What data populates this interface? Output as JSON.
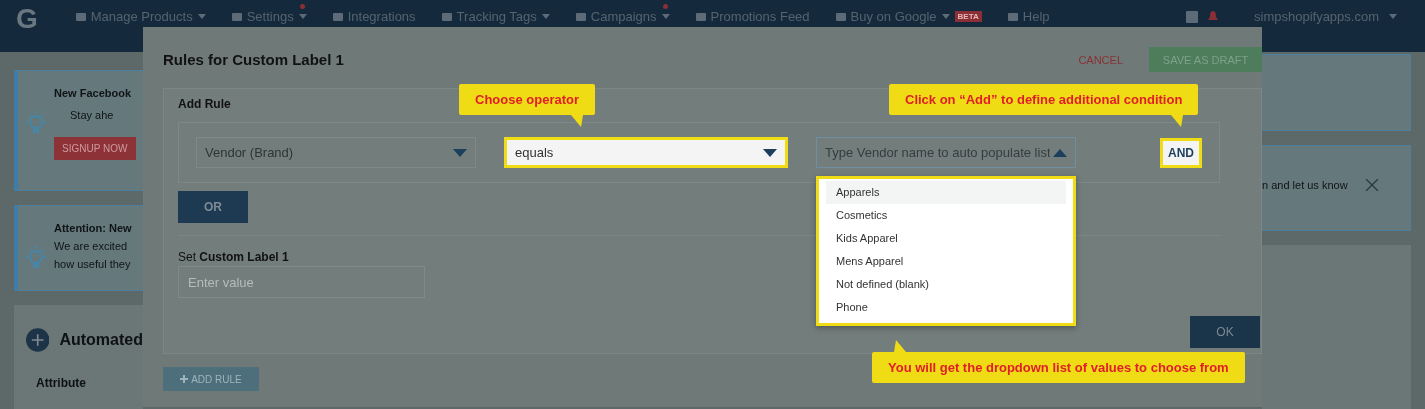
{
  "nav": {
    "logo": "G",
    "items": [
      {
        "label": "Manage Products",
        "caret": true,
        "alert": false
      },
      {
        "label": "Settings",
        "caret": true,
        "alert": true
      },
      {
        "label": "Integrations",
        "caret": false,
        "alert": false
      },
      {
        "label": "Tracking Tags",
        "caret": true,
        "alert": false
      },
      {
        "label": "Campaigns",
        "caret": true,
        "alert": true
      },
      {
        "label": "Promotions Feed",
        "caret": false,
        "alert": false
      },
      {
        "label": "Buy on Google",
        "caret": true,
        "alert": false,
        "badge": "BETA"
      },
      {
        "label": "Help",
        "caret": false,
        "alert": false
      }
    ],
    "account": "simpshopifyapps.com"
  },
  "left": {
    "cards": [
      {
        "kind": "signup",
        "title": "New Facebook",
        "bullet": "Stay ahe",
        "button": "SIGNUP NOW"
      },
      {
        "kind": "notice",
        "title": "Attention: New",
        "lines": [
          "We are excited",
          "how useful they"
        ]
      },
      {
        "kind": "section",
        "title": "Automated",
        "column": "Attribute"
      }
    ]
  },
  "right": {
    "notice_text": "n and let us know"
  },
  "modal": {
    "title": "Rules for Custom Label 1",
    "cancel": "CANCEL",
    "save": "SAVE AS DRAFT",
    "add_rule_heading": "Add Rule",
    "attribute": {
      "value": "Vendor (Brand)",
      "highlighted": false
    },
    "operator": {
      "value": "equals",
      "highlighted": true
    },
    "vendor_field": {
      "placeholder": "Type Vendor name to auto populate list",
      "expanded": true
    },
    "and_button": {
      "label": "AND",
      "highlighted": true
    },
    "or_button": "OR",
    "set_label": "Set **Custom Label 1**",
    "value_field": {
      "placeholder": "Enter value"
    },
    "ok": "OK",
    "add_rule": "ADD RULE",
    "dropdown": [
      {
        "label": "Apparels",
        "selected": true
      },
      {
        "label": "Cosmetics",
        "selected": false
      },
      {
        "label": "Kids Apparel",
        "selected": false
      },
      {
        "label": "Mens Apparel",
        "selected": false
      },
      {
        "label": "Not defined (blank)",
        "selected": false
      },
      {
        "label": "Phone",
        "selected": false
      }
    ]
  },
  "callouts": [
    {
      "text": "Choose operator"
    },
    {
      "text": "Click on “Add” to define additional condition"
    },
    {
      "text": "You will get the dropdown list of values to choose from"
    }
  ]
}
